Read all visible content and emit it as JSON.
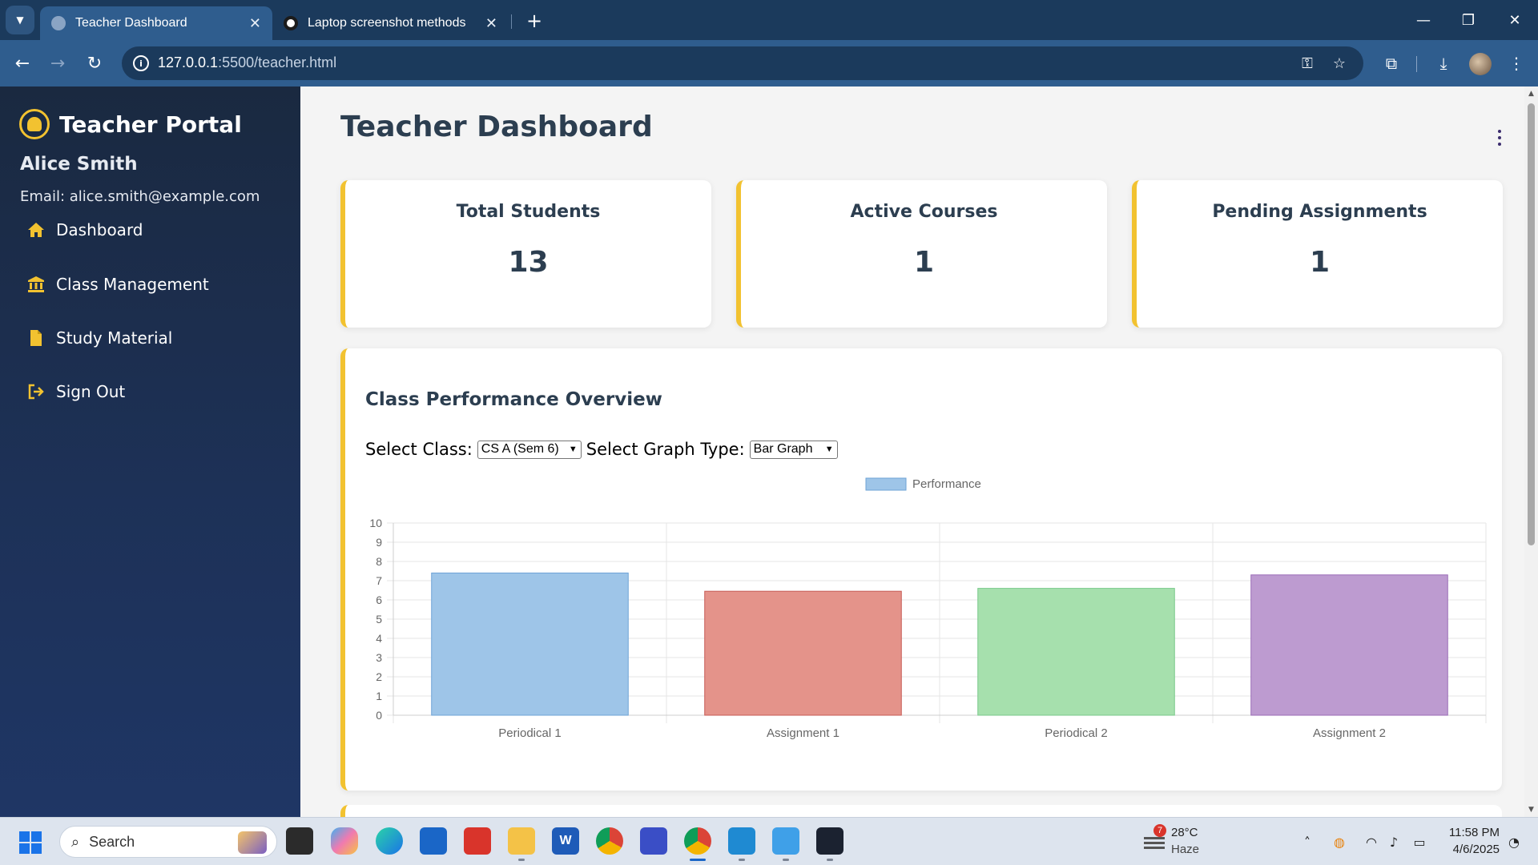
{
  "browser": {
    "tabs": [
      {
        "title": "Teacher Dashboard",
        "active": true
      },
      {
        "title": "Laptop screenshot methods",
        "active": false
      }
    ],
    "url_host": "127.0.0.1",
    "url_rest": ":5500/teacher.html"
  },
  "sidebar": {
    "brand": "Teacher Portal",
    "user_name": "Alice Smith",
    "user_email": "Email: alice.smith@example.com",
    "items": [
      {
        "label": "Dashboard",
        "icon": "home-icon"
      },
      {
        "label": "Class Management",
        "icon": "institution-icon"
      },
      {
        "label": "Study Material",
        "icon": "file-icon"
      },
      {
        "label": "Sign Out",
        "icon": "sign-out-icon"
      }
    ]
  },
  "main": {
    "title": "Teacher Dashboard",
    "cards": [
      {
        "label": "Total Students",
        "value": "13"
      },
      {
        "label": "Active Courses",
        "value": "1"
      },
      {
        "label": "Pending Assignments",
        "value": "1"
      }
    ],
    "performance": {
      "title": "Class Performance Overview",
      "class_label": "Select Class:",
      "class_value": "CS A (Sem 6)",
      "graph_label": "Select Graph Type:",
      "graph_value": "Bar Graph"
    }
  },
  "chart_data": {
    "type": "bar",
    "categories": [
      "Periodical 1",
      "Assignment 1",
      "Periodical 2",
      "Assignment 2"
    ],
    "series": [
      {
        "name": "Performance",
        "values": [
          7.4,
          6.45,
          6.6,
          7.3
        ]
      }
    ],
    "bar_colors": [
      "#9ec5e8",
      "#e4938a",
      "#a6e0ad",
      "#bd9bd0"
    ],
    "bar_borders": [
      "#6ea3d6",
      "#c65b55",
      "#79c98a",
      "#9a6bb6"
    ],
    "legend_color": "#9ec5e8",
    "ylim": [
      0,
      10
    ],
    "yticks": [
      0,
      1,
      2,
      3,
      4,
      5,
      6,
      7,
      8,
      9,
      10
    ],
    "legend": "top",
    "grid": true
  },
  "taskbar": {
    "search_placeholder": "Search",
    "weather_temp": "28°C",
    "weather_desc": "Haze",
    "weather_badge": "7",
    "time": "11:58 PM",
    "date": "4/6/2025"
  }
}
